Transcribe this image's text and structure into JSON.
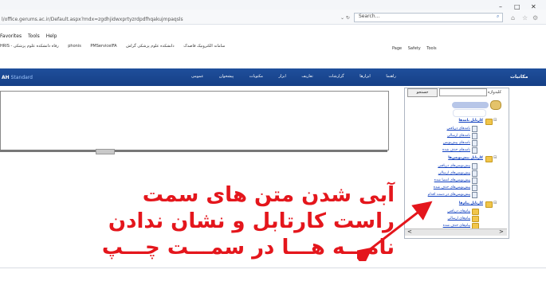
{
  "browser": {
    "url": "l/office.gerums.ac.ir/Default.aspx?mdx=zgdhjidwxprtyzrdpdfhqakujmpaqsls",
    "search_placeholder": "Search...",
    "menu": [
      "Favorites",
      "Tools",
      "Help"
    ],
    "favorites": [
      "HRIS - رفاه",
      "دانشکده علوم پزشکی phonis",
      "دانشکده علوم پزشکی گراش",
      "سامانه الکترونیک قاصدک",
      "PMServiceIFA"
    ],
    "command_bar": [
      "Page",
      "Safety",
      "Tools"
    ]
  },
  "app": {
    "logo": "AH",
    "edition": "Standard",
    "title": "مکاتبات",
    "nav": [
      "راهنما",
      "ابزارها",
      "گزارشات",
      "تعاریف",
      "ابزار",
      "مکتوبات",
      "پیشخوان",
      "عمومی"
    ]
  },
  "tree": {
    "search_label": "کلیدواژه",
    "search_button": "جستجو",
    "sections": [
      {
        "title": "کارتابل نامه‌ها",
        "items": [
          "نامه‌های دریافتی",
          "نامه‌های ارسالی",
          "نامه‌های پیش‌نویس",
          "نامه‌های حذف شده"
        ]
      },
      {
        "title": "کارتابل پیش‌نویس‌ها",
        "items": [
          "پیش‌نویس‌های دریافتی",
          "پیش‌نویس‌های ارسالی",
          "پیش‌نویس‌های امضا شده",
          "پیش‌نویس‌های حذف شده",
          "پیش‌نویس‌های در دست اقدام"
        ]
      },
      {
        "title": "کارتابل پیام‌ها",
        "items": [
          "پیام‌های دریافتی",
          "پیام‌های ارسالی",
          "پیام‌های حذف شده"
        ]
      }
    ]
  },
  "annotation": {
    "lines": [
      "آبی شدن متن های سمت",
      "راست کارتابل و نشان ندادن",
      "نامـــه هـــا در سمـــت چـــپ"
    ]
  },
  "colors": {
    "accent": "#1f4f9c",
    "annotation": "#e4161c",
    "link": "#0f3fbf"
  }
}
